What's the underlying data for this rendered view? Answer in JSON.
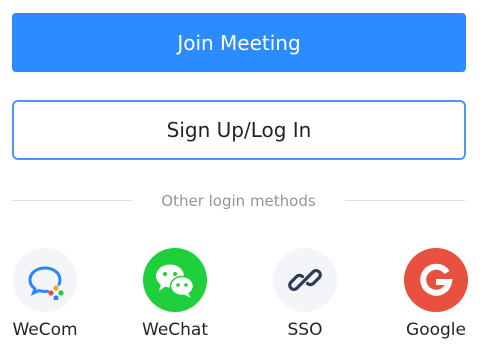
{
  "buttons": {
    "join_meeting": "Join Meeting",
    "sign_up_log_in": "Sign Up/Log In"
  },
  "divider": {
    "label": "Other login methods"
  },
  "login_methods": [
    {
      "label": "WeCom",
      "icon": "wecom-icon"
    },
    {
      "label": "WeChat",
      "icon": "wechat-icon"
    },
    {
      "label": "SSO",
      "icon": "link-icon"
    },
    {
      "label": "Google",
      "icon": "google-icon"
    }
  ],
  "colors": {
    "primary": "#2b8cff",
    "outline": "#4a95ff",
    "wechat_green": "#1fcf3c",
    "google_red": "#e8503f",
    "muted_text": "#8f959e"
  }
}
